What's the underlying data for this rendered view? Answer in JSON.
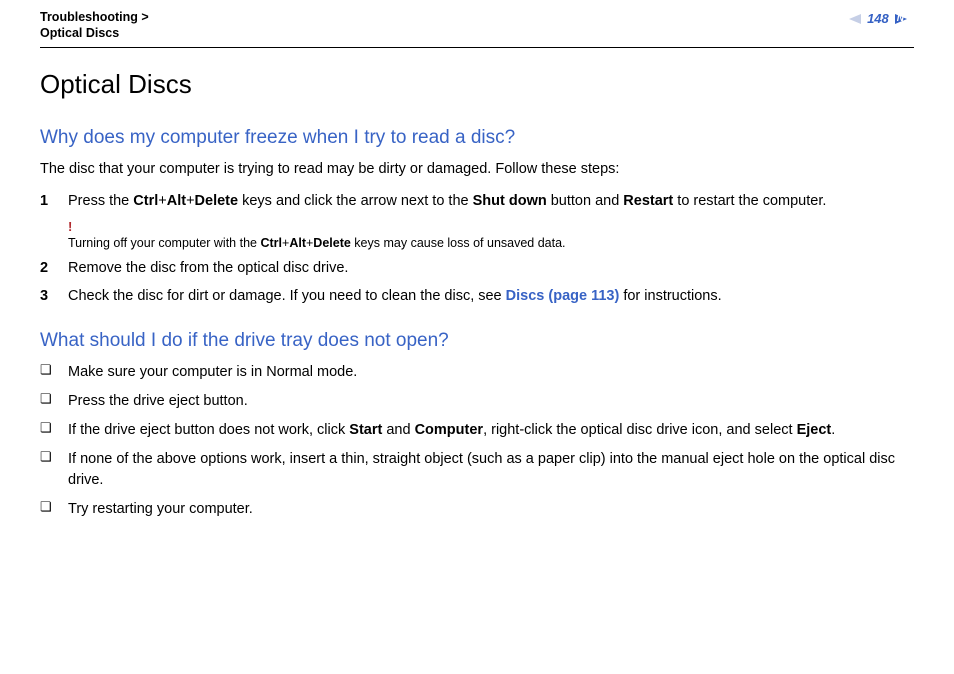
{
  "breadcrumb": {
    "parent": "Troubleshooting",
    "sep": ">",
    "current": "Optical Discs"
  },
  "page_number": "148",
  "title": "Optical Discs",
  "section1": {
    "heading": "Why does my computer freeze when I try to read a disc?",
    "intro": "The disc that your computer is trying to read may be dirty or damaged. Follow these steps:",
    "steps": [
      {
        "num": "1",
        "pre": "Press the ",
        "k1": "Ctrl",
        "p1": "+",
        "k2": "Alt",
        "p2": "+",
        "k3": "Delete",
        "mid1": " keys and click the arrow next to the ",
        "b1": "Shut down",
        "mid2": " button and ",
        "b2": "Restart",
        "post": " to restart the computer.",
        "warn": {
          "excl": "!",
          "pre": "Turning off your computer with the ",
          "k1": "Ctrl",
          "p1": "+",
          "k2": "Alt",
          "p2": "+",
          "k3": "Delete",
          "post": " keys may cause loss of unsaved data."
        }
      },
      {
        "num": "2",
        "text": "Remove the disc from the optical disc drive."
      },
      {
        "num": "3",
        "pre": "Check the disc for dirt or damage. If you need to clean the disc, see ",
        "link": "Discs (page 113)",
        "post": " for instructions."
      }
    ]
  },
  "section2": {
    "heading": "What should I do if the drive tray does not open?",
    "bullets": [
      {
        "text": "Make sure your computer is in Normal mode."
      },
      {
        "text": "Press the drive eject button."
      },
      {
        "pre": "If the drive eject button does not work, click ",
        "b1": "Start",
        "mid1": " and ",
        "b2": "Computer",
        "mid2": ", right-click the optical disc drive icon, and select ",
        "b3": "Eject",
        "post": "."
      },
      {
        "text": "If none of the above options work, insert a thin, straight object (such as a paper clip) into the manual eject hole on the optical disc drive."
      },
      {
        "text": "Try restarting your computer."
      }
    ]
  },
  "bullet_marker": "❏"
}
